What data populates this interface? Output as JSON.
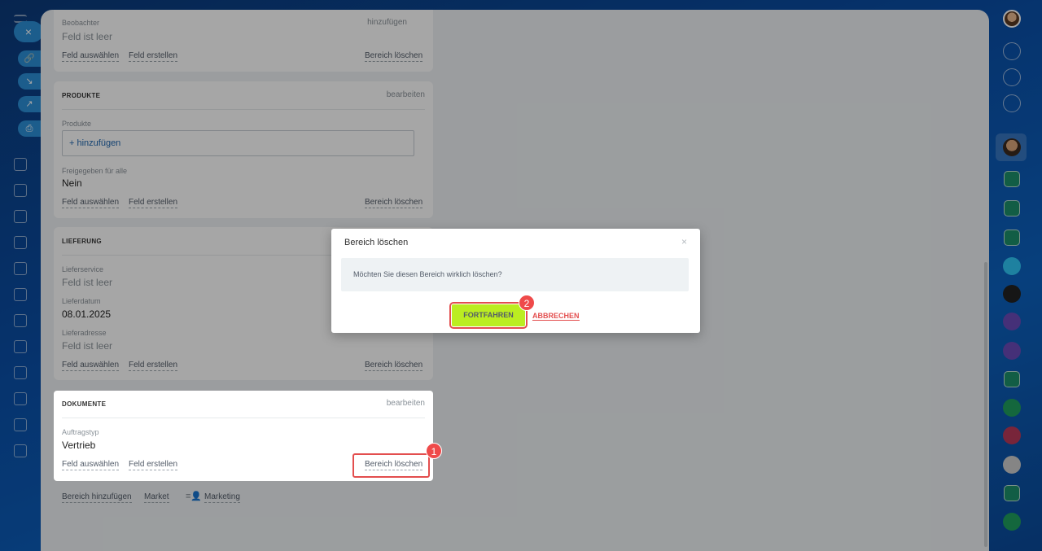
{
  "colors": {
    "accent_green": "#bbed21",
    "marker_red": "#ef4a4a",
    "link_blue": "#2067b0"
  },
  "left_rail": {
    "close_glyph": "×"
  },
  "cards": {
    "beobachter": {
      "field_label": "Beobachter",
      "field_value": "Feld ist leer",
      "add_label": "hinzufügen",
      "select_field": "Feld auswählen",
      "create_field": "Feld erstellen",
      "delete_section": "Bereich löschen"
    },
    "produkte": {
      "title": "PRODUKTE",
      "edit": "bearbeiten",
      "products_label": "Produkte",
      "add_products": "+ hinzufügen",
      "shared_label": "Freigegeben für alle",
      "shared_value": "Nein",
      "select_field": "Feld auswählen",
      "create_field": "Feld erstellen",
      "delete_section": "Bereich löschen"
    },
    "lieferung": {
      "title": "LIEFERUNG",
      "service_label": "Lieferservice",
      "service_value": "Feld ist leer",
      "date_label": "Lieferdatum",
      "date_value": "08.01.2025",
      "address_label": "Lieferadresse",
      "address_value": "Feld ist leer",
      "select_field": "Feld auswählen",
      "create_field": "Feld erstellen",
      "delete_section": "Bereich löschen"
    },
    "dokumente": {
      "title": "DOKUMENTE",
      "edit": "bearbeiten",
      "type_label": "Auftragstyp",
      "type_value": "Vertrieb",
      "select_field": "Feld auswählen",
      "create_field": "Feld erstellen",
      "delete_section": "Bereich löschen"
    }
  },
  "footer": {
    "add_section": "Bereich hinzufügen",
    "market": "Market",
    "marketing": "Marketing"
  },
  "dialog": {
    "title": "Bereich löschen",
    "close": "×",
    "message": "Möchten Sie diesen Bereich wirklich löschen?",
    "continue": "FORTFAHREN",
    "cancel": "ABBRECHEN"
  },
  "markers": {
    "one": "1",
    "two": "2"
  }
}
